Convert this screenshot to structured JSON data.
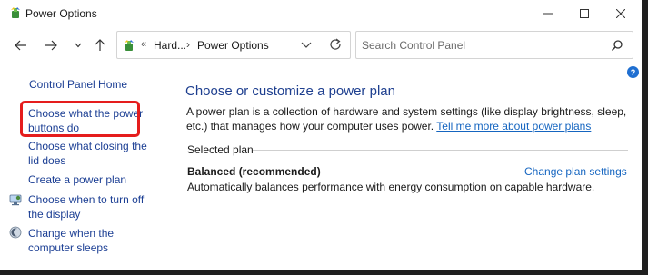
{
  "window": {
    "title": "Power Options"
  },
  "address": {
    "prefix": "«",
    "crumbs": [
      "Hard...",
      "Power Options"
    ],
    "separator": "›"
  },
  "search": {
    "placeholder": "Search Control Panel"
  },
  "leftnav": {
    "home": "Control Panel Home",
    "items": [
      "Choose what the power buttons do",
      "Choose what closing the lid does",
      "Create a power plan",
      "Choose when to turn off the display",
      "Change when the computer sleeps"
    ]
  },
  "help": {
    "label": "?"
  },
  "main": {
    "title": "Choose or customize a power plan",
    "description": "A power plan is a collection of hardware and system settings (like display brightness, sleep, etc.) that manages how your computer uses power.",
    "learn_more": "Tell me more about power plans",
    "selected_plan_label": "Selected plan",
    "plan": {
      "name": "Balanced (recommended)",
      "change_link": "Change plan settings",
      "description": "Automatically balances performance with energy consumption on capable hardware."
    }
  },
  "colors": {
    "link": "#1c3f94",
    "accent_link": "#1565c0",
    "heading": "#1e3f8f",
    "highlight_border": "#e51d1d",
    "help_badge": "#1f6fd1"
  },
  "icons": {
    "app": "power-options-icon",
    "back": "arrow-left-icon",
    "forward": "arrow-right-icon",
    "recent": "chevron-down-icon",
    "up": "arrow-up-icon",
    "dropdown": "chevron-down-icon",
    "refresh": "refresh-icon",
    "search": "search-icon",
    "display": "monitor-icon",
    "sleep": "moon-icon",
    "help": "help-icon"
  }
}
